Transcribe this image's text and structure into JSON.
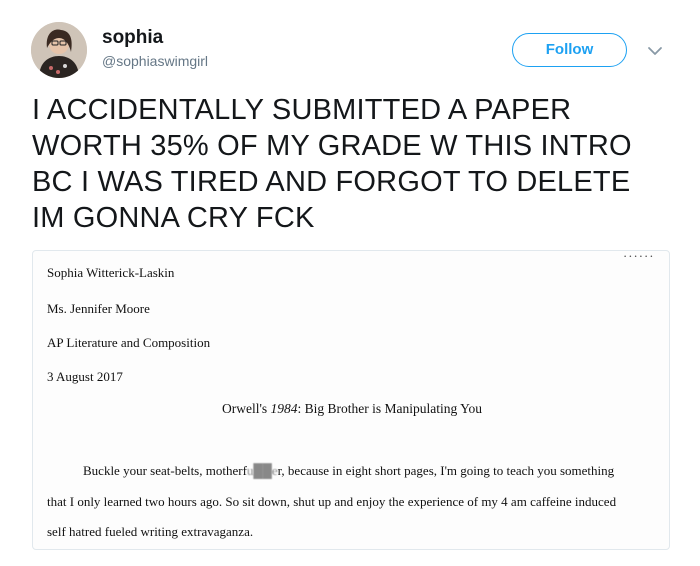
{
  "user": {
    "display_name": "sophia",
    "handle": "@sophiaswimgirl"
  },
  "actions": {
    "follow_label": "Follow"
  },
  "tweet": {
    "lines": [
      "I ACCIDENTALLY SUBMITTED A PAPER",
      "WORTH 35% OF MY GRADE W THIS INTRO",
      "BC I WAS TIRED AND FORGOT TO DELETE",
      "IM GONNA CRY FCK"
    ]
  },
  "paper": {
    "corner_mark": "......",
    "author": "Sophia Witterick-Laskin",
    "teacher": "Ms. Jennifer Moore",
    "course": "AP Literature and Composition",
    "date": "3 August 2017",
    "title_prefix": "Orwell's",
    "title_italic": "1984",
    "title_suffix": ": Big Brother is Manipulating You",
    "body_line1_start": "Buckle your seat-belts, motherf",
    "body_line1_obscured": "u██e",
    "body_line1_end": "r, because in eight short pages, I'm going to teach you something",
    "body_line2": "that I only learned two hours ago. So sit down, shut up and enjoy the experience of my 4 am caffeine induced",
    "body_line3": "self hatred fueled writing extravaganza."
  },
  "colors": {
    "accent": "#1da1f2",
    "handle": "#657786",
    "text": "#14171a",
    "media_border": "#e1e8ed"
  },
  "icons": {
    "avatar": "profile-photo",
    "chevron": "chevron-down-icon"
  }
}
